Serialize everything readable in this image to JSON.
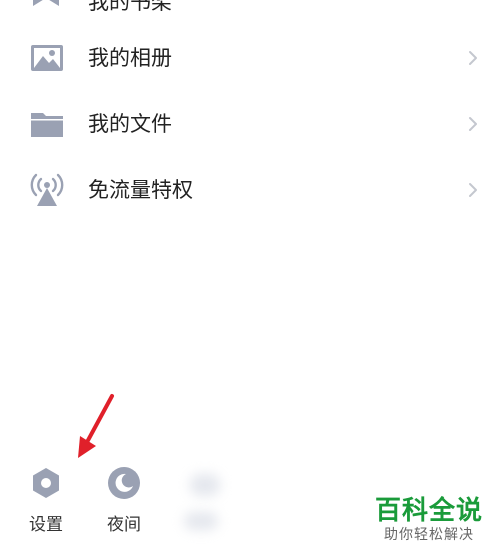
{
  "menu": {
    "partial_item": {
      "label": "我的书架",
      "icon": "bookmark-icon"
    },
    "items": [
      {
        "label": "我的相册",
        "icon": "image-icon"
      },
      {
        "label": "我的文件",
        "icon": "folder-icon"
      },
      {
        "label": "免流量特权",
        "icon": "signal-tower-icon"
      }
    ]
  },
  "toolbar": {
    "settings_label": "设置",
    "night_label": "夜间"
  },
  "watermark": {
    "title": "百科全说",
    "subtitle": "助你轻松解决"
  },
  "colors": {
    "icon_gray": "#9aa1b3",
    "chevron": "#c4c7cf",
    "annotation_red": "#e0202a",
    "watermark_green": "#1a9b3a"
  }
}
